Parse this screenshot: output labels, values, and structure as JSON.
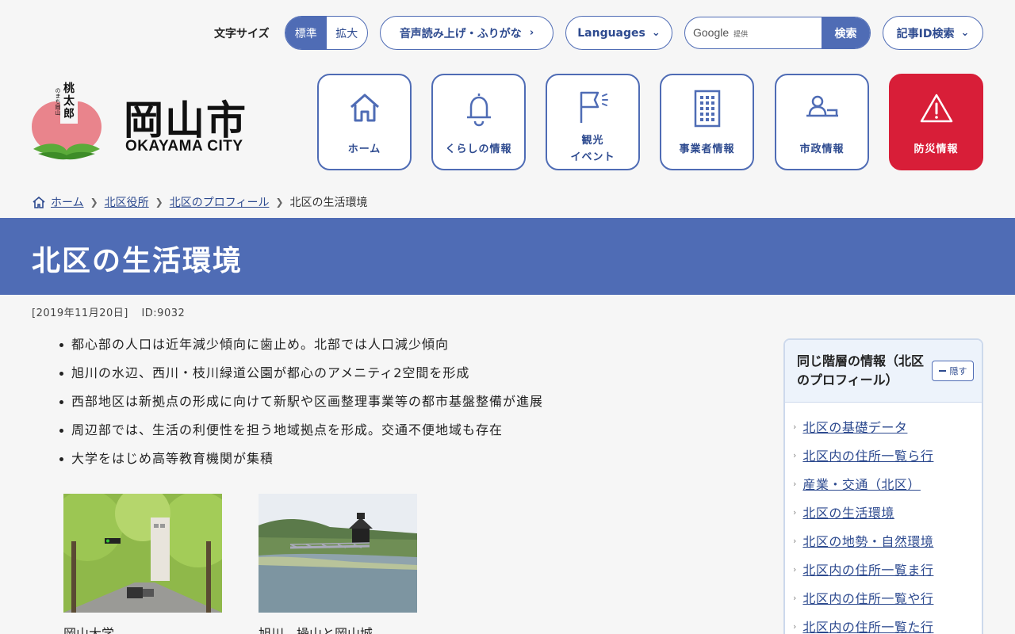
{
  "utility": {
    "font_size_label": "文字サイズ",
    "font_size_options": [
      "標準",
      "拡大"
    ],
    "font_size_selected": "標準",
    "read_aloud": "音声読み上げ・ふりがな",
    "languages": "Languages",
    "search": {
      "brand": "Google",
      "brand_sub": "提供",
      "placeholder": "",
      "button": "検索"
    },
    "article_id_search": "記事ID検索"
  },
  "logo": {
    "title": "岡山市",
    "subtitle": "OKAYAMA CITY",
    "mascot_text": "桃太郎のまち岡山"
  },
  "nav": [
    {
      "label": "ホーム",
      "icon": "home-icon"
    },
    {
      "label": "くらしの情報",
      "icon": "bell-icon"
    },
    {
      "label_line1": "観光",
      "label_line2": "イベント",
      "icon": "flag-icon"
    },
    {
      "label": "事業者情報",
      "icon": "building-icon"
    },
    {
      "label": "市政情報",
      "icon": "person-desk-icon"
    },
    {
      "label": "防災情報",
      "icon": "warning-icon"
    }
  ],
  "breadcrumb": [
    "ホーム",
    "北区役所",
    "北区のプロフィール",
    "北区の生活環境"
  ],
  "page": {
    "title": "北区の生活環境",
    "date": "[2019年11月20日]",
    "id": "ID:9032",
    "bullets": [
      "都心部の人口は近年減少傾向に歯止め。北部では人口減少傾向",
      "旭川の水辺、西川・枝川緑道公園が都心のアメニティ2空間を形成",
      "西部地区は新拠点の形成に向けて新駅や区画整理事業等の都市基盤整備が進展",
      "周辺部では、生活の利便性を担う地域拠点を形成。交通不便地域も存在",
      "大学をはじめ高等教育機関が集積"
    ],
    "photos": [
      {
        "caption": "岡山大学"
      },
      {
        "caption": "旭川、操山と岡山城"
      }
    ]
  },
  "sidebar": {
    "title": "同じ階層の情報（北区のプロフィール）",
    "hide_label": "隠す",
    "links": [
      "北区の基礎データ",
      "北区内の住所一覧ら行",
      "産業・交通（北区）",
      "北区の生活環境",
      "北区の地勢・自然環境",
      "北区内の住所一覧ま行",
      "北区内の住所一覧や行",
      "北区内の住所一覧た行"
    ]
  },
  "colors": {
    "primary": "#4f6cb5",
    "danger": "#d81e38",
    "background": "#f6f6f6"
  }
}
